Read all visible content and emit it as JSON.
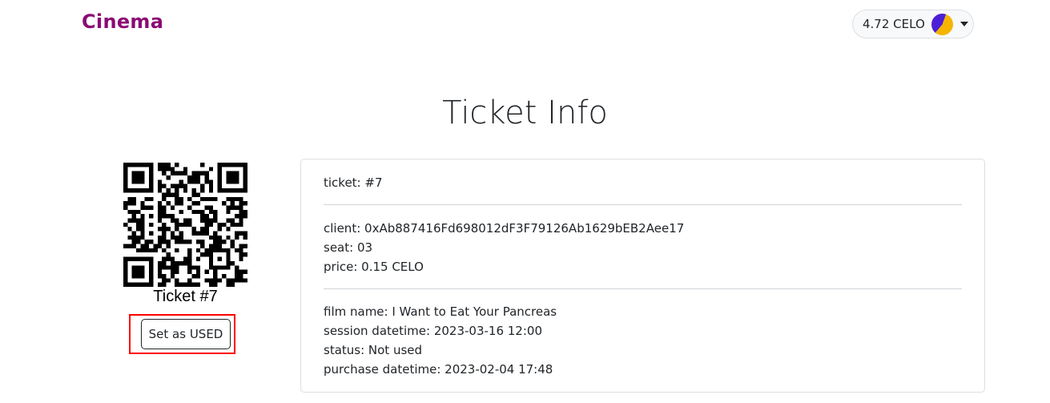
{
  "header": {
    "brand": "Cinema",
    "wallet_balance": "4.72 CELO"
  },
  "page_title": "Ticket Info",
  "ticket": {
    "qr_label": "Ticket #7",
    "set_used_label": "Set as USED"
  },
  "details": {
    "ticket_line": "ticket: #7",
    "client_line": "client: 0xAb887416Fd698012dF3F79126Ab1629bEB2Aee17",
    "seat_line": "seat: 03",
    "price_line": "price: 0.15 CELO",
    "film_line": "film name: I Want to Eat Your Pancreas",
    "session_line": "session datetime: 2023-03-16 12:00",
    "status_line": "status: Not used",
    "purchase_line": "purchase datetime: 2023-02-04 17:48"
  },
  "colors": {
    "brand": "#8b0a74",
    "highlight": "#ff0000",
    "avatar_primary": "#f5b400",
    "avatar_secondary": "#4b1fd6"
  },
  "icons": {
    "wallet_avatar": "wallet-avatar-icon",
    "dropdown": "caret-down-icon",
    "qr": "qr-code"
  }
}
